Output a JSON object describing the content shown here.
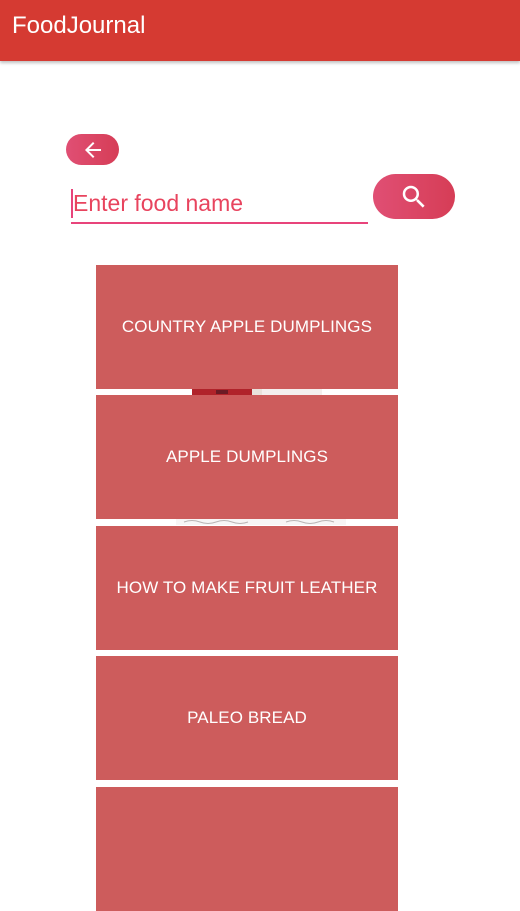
{
  "app_bar": {
    "title": "FoodJournal",
    "color": "#d53a32"
  },
  "navigation": {
    "back_icon": "arrow-left-icon"
  },
  "search": {
    "placeholder": "Enter food name",
    "value": "",
    "button_icon": "search-icon",
    "accent_color": "#e8447b"
  },
  "results": {
    "tile_color": "#cd5c5c",
    "items": [
      {
        "label": "COUNTRY APPLE DUMPLINGS"
      },
      {
        "label": "APPLE DUMPLINGS"
      },
      {
        "label": "HOW TO MAKE FRUIT LEATHER"
      },
      {
        "label": "PALEO BREAD"
      },
      {
        "label": ""
      }
    ]
  }
}
